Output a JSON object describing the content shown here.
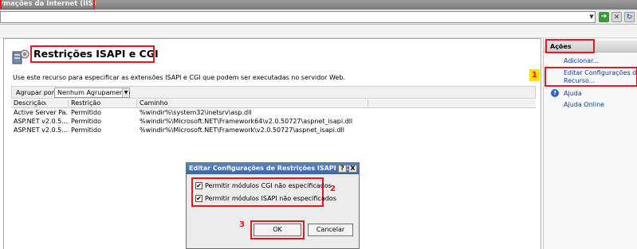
{
  "window": {
    "title": "rmações da Internet (IIS)"
  },
  "address_bar": {
    "value": ""
  },
  "page": {
    "title": "Restrições ISAPI e CGI",
    "description": "Use este recurso para especificar as extensões ISAPI e CGI que podem ser executadas no servidor Web.",
    "group_by_label": "Agrupar por:",
    "group_by_value": "Nenhum Agrupamento"
  },
  "table": {
    "columns": [
      "Descrição",
      "Restrição",
      "Caminho"
    ],
    "rows": [
      [
        "Active Server Pa...",
        "Permitido",
        "%windir%\\system32\\inetsrv\\asp.dll"
      ],
      [
        "ASP.NET v2.0.5...",
        "Permitido",
        "%windir%\\Microsoft.NET\\Framework64\\v2.0.50727\\aspnet_isapi.dll"
      ],
      [
        "ASP.NET v2.0.5...",
        "Permitido",
        "%windir%\\Microsoft.NET\\Framework\\v2.0.50727\\aspnet_isapi.dll"
      ]
    ]
  },
  "actions": {
    "title": "Ações",
    "add": "Adicionar...",
    "edit_line1": "Editar Configurações de",
    "edit_line2": "Recurso...",
    "help": "Ajuda",
    "help_online": "Ajuda Online"
  },
  "dialog": {
    "title": "Editar Configurações de Restrições ISAPI e C...",
    "help_btn": "?",
    "close_btn": "X",
    "check_cgi": "Permitir módulos CGI não especificados",
    "check_isapi": "Permitir módulos ISAPI não especificados",
    "ok": "OK",
    "cancel": "Cancelar",
    "check_cgi_checked": true,
    "check_isapi_checked": true
  },
  "annotations": {
    "n1": "1",
    "n2": "2",
    "n3": "3"
  },
  "colors": {
    "annotation_red": "#e8171b",
    "badge_yellow": "#ffe100",
    "link_blue": "#0b3c9e"
  }
}
